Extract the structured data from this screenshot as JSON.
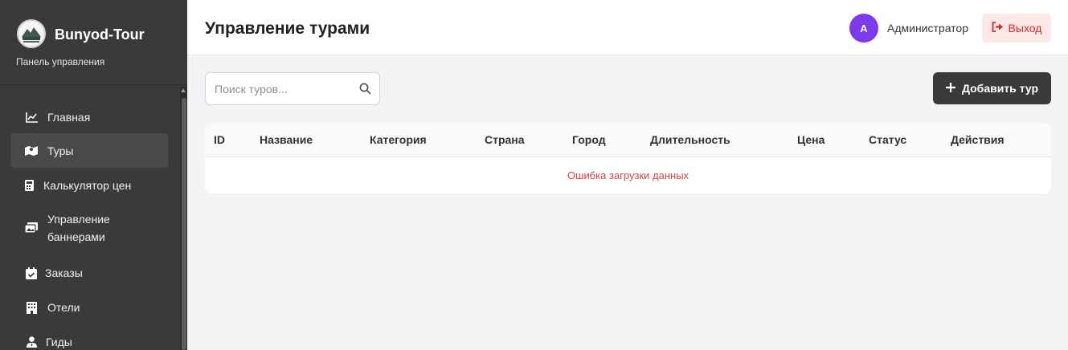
{
  "sidebar": {
    "brand_name": "Bunyod-Tour",
    "brand_sub": "Панель управления",
    "items": [
      {
        "label": "Главная",
        "icon": "chart-line-icon"
      },
      {
        "label": "Туры",
        "icon": "map-icon"
      },
      {
        "label": "Калькулятор цен",
        "icon": "calculator-icon"
      },
      {
        "label": "Управление баннерами",
        "icon": "images-icon"
      },
      {
        "label": "Заказы",
        "icon": "calendar-check-icon"
      },
      {
        "label": "Отели",
        "icon": "building-icon"
      },
      {
        "label": "Гиды",
        "icon": "user-tie-icon"
      }
    ],
    "active_item": "Туры"
  },
  "header": {
    "title": "Управление турами",
    "avatar_letter": "A",
    "username": "Администратор",
    "logout_label": "Выход"
  },
  "toolbar": {
    "search_placeholder": "Поиск туров...",
    "add_label": "Добавить тур"
  },
  "table": {
    "columns": [
      "ID",
      "Название",
      "Категория",
      "Страна",
      "Город",
      "Длительность",
      "Цена",
      "Статус",
      "Действия"
    ],
    "error_message": "Ошибка загрузки данных"
  },
  "colors": {
    "sidebar_bg": "#3a3a3a",
    "avatar": "#7c3aed",
    "logout_text": "#dc2626",
    "logout_bg": "#fde8e8",
    "error_text": "#d64545"
  }
}
